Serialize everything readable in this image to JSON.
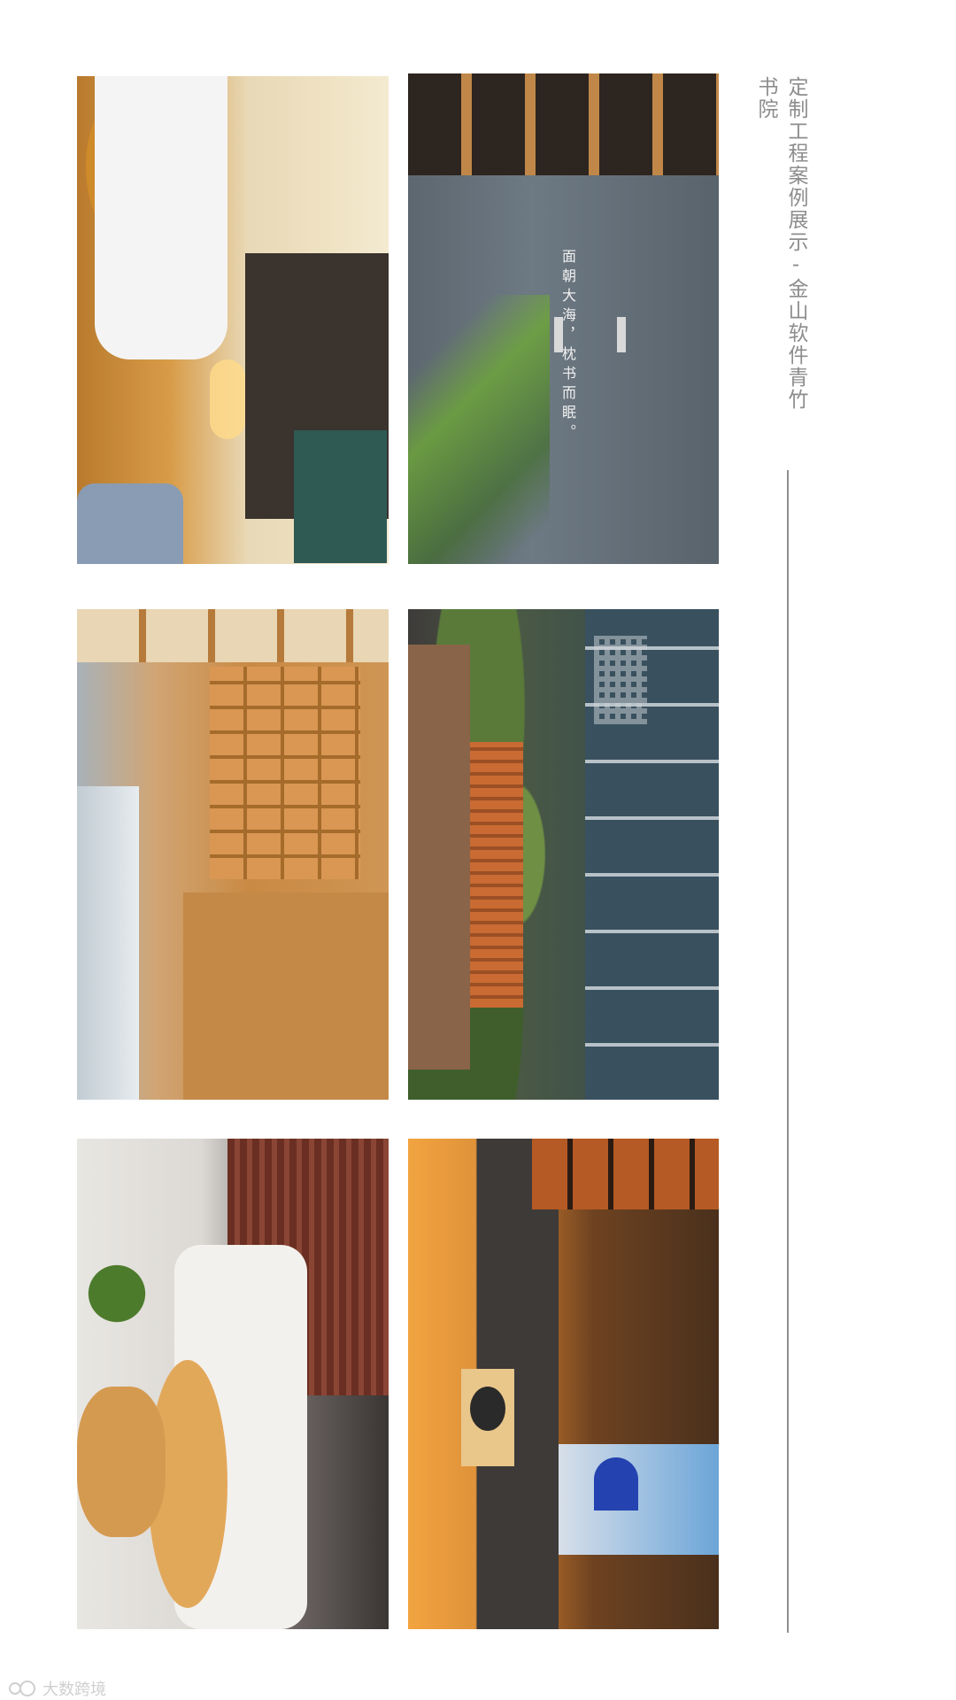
{
  "title": "定制工程案例展示-金山软件青竹书院",
  "photos": [
    {
      "id": "bedroom"
    },
    {
      "id": "sea-wall",
      "text": "面朝大海，枕书而眠。"
    },
    {
      "id": "library"
    },
    {
      "id": "garden-corridor"
    },
    {
      "id": "lounge"
    },
    {
      "id": "tea-room"
    }
  ],
  "watermark": "大数跨境",
  "colors": {
    "title": "#8d8d8d",
    "rule": "#8f8f8f",
    "background": "#ffffff"
  }
}
